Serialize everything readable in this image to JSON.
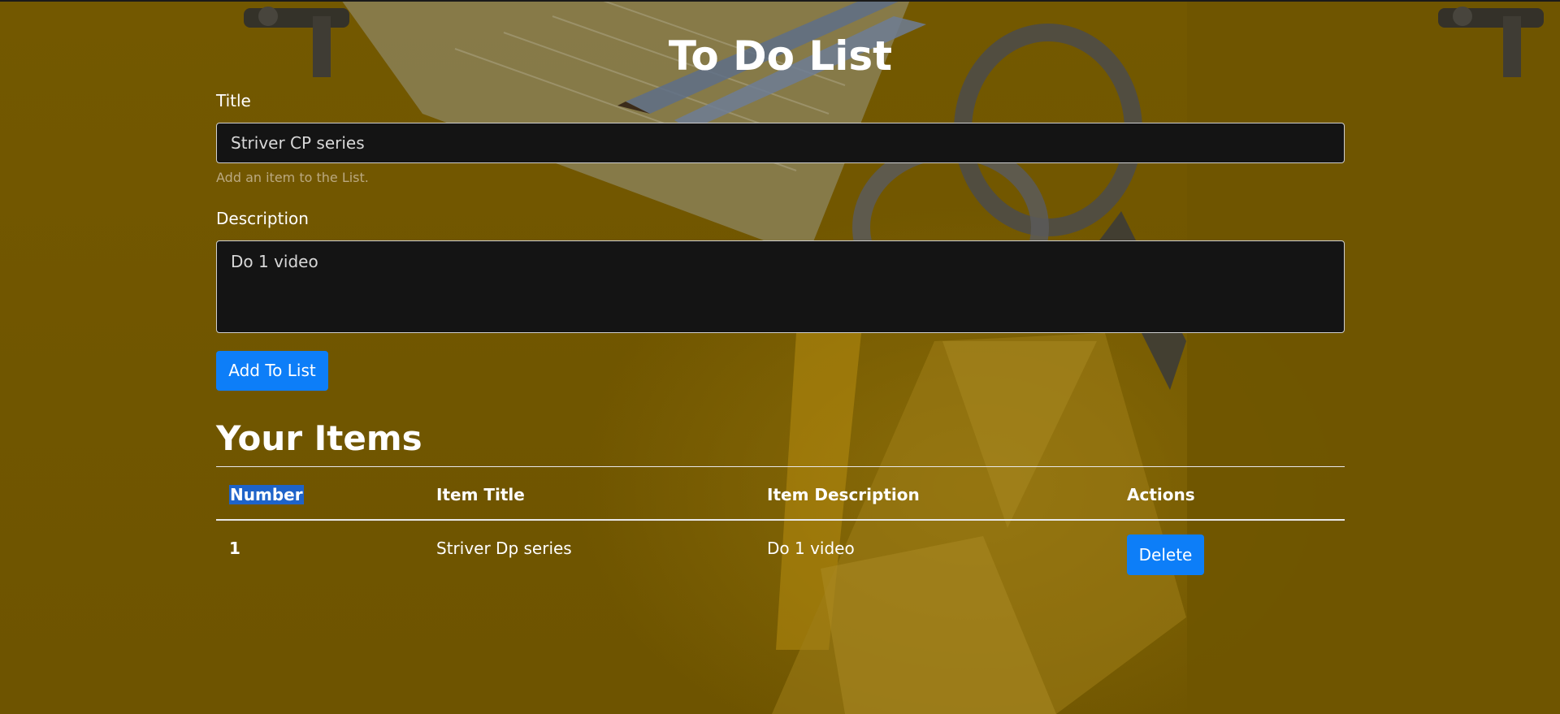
{
  "page": {
    "title": "To Do List"
  },
  "form": {
    "title_label": "Title",
    "title_value": "Striver CP series",
    "title_help": "Add an item to the List.",
    "description_label": "Description",
    "description_value": "Do 1 video",
    "submit_label": "Add To List"
  },
  "items_section": {
    "heading": "Your Items",
    "columns": [
      "Number",
      "Item Title",
      "Item Description",
      "Actions"
    ],
    "rows": [
      {
        "number": "1",
        "title": "Striver Dp series",
        "description": "Do 1 video",
        "action_label": "Delete"
      }
    ]
  },
  "colors": {
    "background": "#6b5200",
    "input_background": "#141414",
    "button_primary": "#0d7ef8",
    "selection_highlight": "#1e63c9"
  },
  "icons": []
}
